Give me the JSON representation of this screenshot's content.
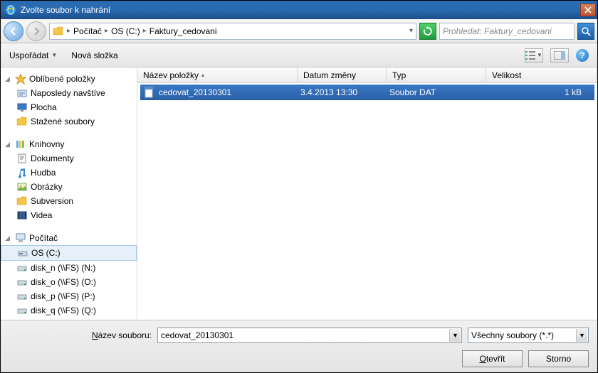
{
  "title": "Zvolte soubor k nahrání",
  "breadcrumb": {
    "p1": "Počítač",
    "p2": "OS (C:)",
    "p3": "Faktury_cedovani"
  },
  "search_placeholder": "Prohledat: Faktury_cedovani",
  "toolbar": {
    "organize": "Uspořádat",
    "newfolder": "Nová složka"
  },
  "columns": {
    "name": "Název položky",
    "date": "Datum změny",
    "type": "Typ",
    "size": "Velikost"
  },
  "sidebar": {
    "favorites": {
      "label": "Oblíbené položky",
      "recent": "Naposledy navštíve",
      "desktop": "Plocha",
      "downloads": "Stažené soubory"
    },
    "libraries": {
      "label": "Knihovny",
      "documents": "Dokumenty",
      "music": "Hudba",
      "pictures": "Obrázky",
      "subversion": "Subversion",
      "videos": "Videa"
    },
    "computer": {
      "label": "Počítač",
      "os": "OS (C:)",
      "d1": "disk_n (\\\\FS) (N:)",
      "d2": "disk_o (\\\\FS) (O:)",
      "d3": "disk_p (\\\\FS) (P:)",
      "d4": "disk_q (\\\\FS) (Q:)"
    }
  },
  "file": {
    "name": "cedovat_20130301",
    "date": "3.4.2013 13:30",
    "type": "Soubor DAT",
    "size": "1 kB"
  },
  "filename_label": "ázev souboru:",
  "filename_value": "cedovat_20130301",
  "filter": "Všechny soubory (*.*)",
  "open": "tevřít",
  "cancel": "Storno"
}
